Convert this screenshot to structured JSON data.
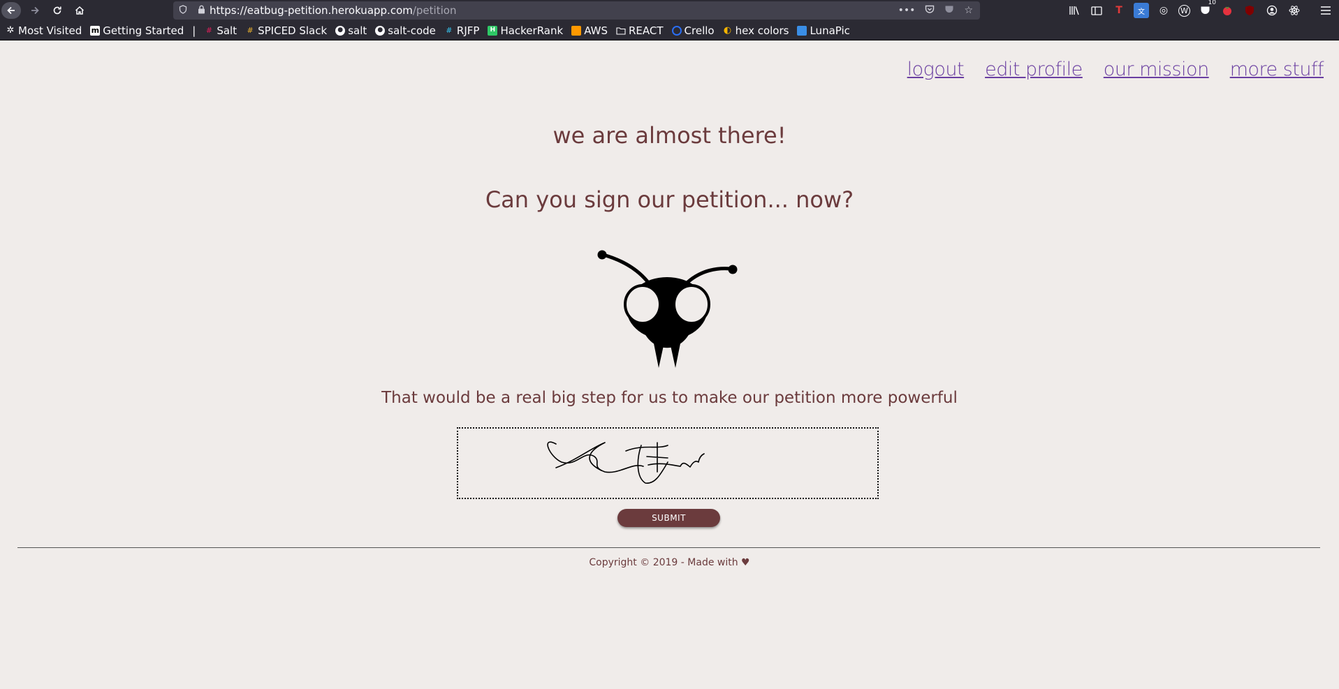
{
  "browser": {
    "url_host": "https://eatbug-petition.herokuapp.com",
    "url_path": "/petition",
    "notification_count": "10",
    "bookmarks": [
      {
        "label": "Most Visited",
        "icon": "gear-icon"
      },
      {
        "label": "Getting Started",
        "icon": "m-icon"
      },
      {
        "label": "Salt",
        "icon": "slack-icon"
      },
      {
        "label": "SPICED Slack",
        "icon": "slack-icon"
      },
      {
        "label": "salt",
        "icon": "github-icon"
      },
      {
        "label": "salt-code",
        "icon": "github-icon"
      },
      {
        "label": "RJFP",
        "icon": "slack-icon"
      },
      {
        "label": "HackerRank",
        "icon": "hackerrank-icon"
      },
      {
        "label": "AWS",
        "icon": "aws-icon"
      },
      {
        "label": "REACT",
        "icon": "folder-icon"
      },
      {
        "label": "Crello",
        "icon": "crello-icon"
      },
      {
        "label": "hex colors",
        "icon": "hex-icon"
      },
      {
        "label": "LunaPic",
        "icon": "lunapic-icon"
      }
    ]
  },
  "nav": {
    "logout": "logout",
    "edit_profile": "edit profile",
    "our_mission": "our mission",
    "more_stuff": "more stuff"
  },
  "main": {
    "title": "we are almost there!",
    "question": "Can you sign our petition... now?",
    "subtext": "That would be a real big step for us to make our petition more powerful",
    "submit_label": "SUBMIT"
  },
  "footer": {
    "text": "Copyright © 2019 - Made with ♥"
  },
  "colors": {
    "page_bg": "#f0ecea",
    "heading": "#6b3b3d",
    "link": "#6a3ea1",
    "button_bg": "#6b3b3d",
    "browser_bg": "#2b2a33"
  }
}
